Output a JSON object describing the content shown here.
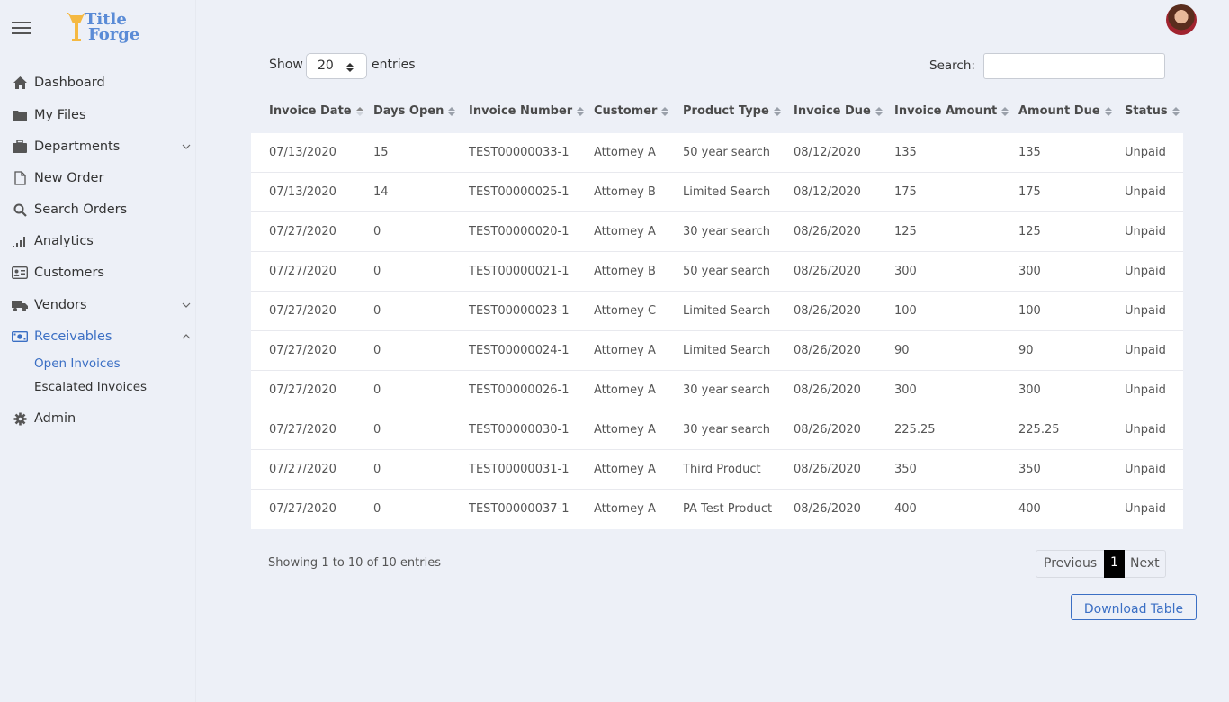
{
  "app": {
    "logo_line1": "Title",
    "logo_line2": "Forge",
    "accent": "#3b6fc4"
  },
  "sidebar": {
    "items": [
      {
        "label": "Dashboard",
        "icon": "home-icon"
      },
      {
        "label": "My Files",
        "icon": "folder-icon"
      },
      {
        "label": "Departments",
        "icon": "briefcase-icon"
      },
      {
        "label": "New Order",
        "icon": "file-icon"
      },
      {
        "label": "Search Orders",
        "icon": "search-icon"
      },
      {
        "label": "Analytics",
        "icon": "signal-bars-icon"
      },
      {
        "label": "Customers",
        "icon": "id-card-icon"
      },
      {
        "label": "Vendors",
        "icon": "truck-icon"
      },
      {
        "label": "Receivables",
        "icon": "money-bill-icon"
      },
      {
        "label": "Admin",
        "icon": "gear-icon"
      }
    ],
    "sub_items": [
      {
        "label": "Open Invoices"
      },
      {
        "label": "Escalated Invoices"
      }
    ]
  },
  "controls": {
    "show_label": "Show",
    "page_size": "20",
    "entries_label": "entries",
    "search_label": "Search:",
    "search_value": ""
  },
  "table": {
    "columns": [
      "Invoice Date",
      "Days Open",
      "Invoice Number",
      "Customer",
      "Product Type",
      "Invoice Due",
      "Invoice Amount",
      "Amount Due",
      "Status"
    ],
    "rows": [
      [
        "07/13/2020",
        "15",
        "TEST00000033-1",
        "Attorney A",
        "50 year search",
        "08/12/2020",
        "135",
        "135",
        "Unpaid"
      ],
      [
        "07/13/2020",
        "14",
        "TEST00000025-1",
        "Attorney B",
        "Limited Search",
        "08/12/2020",
        "175",
        "175",
        "Unpaid"
      ],
      [
        "07/27/2020",
        "0",
        "TEST00000020-1",
        "Attorney A",
        "30 year search",
        "08/26/2020",
        "125",
        "125",
        "Unpaid"
      ],
      [
        "07/27/2020",
        "0",
        "TEST00000021-1",
        "Attorney B",
        "50 year search",
        "08/26/2020",
        "300",
        "300",
        "Unpaid"
      ],
      [
        "07/27/2020",
        "0",
        "TEST00000023-1",
        "Attorney C",
        "Limited Search",
        "08/26/2020",
        "100",
        "100",
        "Unpaid"
      ],
      [
        "07/27/2020",
        "0",
        "TEST00000024-1",
        "Attorney A",
        "Limited Search",
        "08/26/2020",
        "90",
        "90",
        "Unpaid"
      ],
      [
        "07/27/2020",
        "0",
        "TEST00000026-1",
        "Attorney A",
        "30 year search",
        "08/26/2020",
        "300",
        "300",
        "Unpaid"
      ],
      [
        "07/27/2020",
        "0",
        "TEST00000030-1",
        "Attorney A",
        "30 year search",
        "08/26/2020",
        "225.25",
        "225.25",
        "Unpaid"
      ],
      [
        "07/27/2020",
        "0",
        "TEST00000031-1",
        "Attorney A",
        "Third Product",
        "08/26/2020",
        "350",
        "350",
        "Unpaid"
      ],
      [
        "07/27/2020",
        "0",
        "TEST00000037-1",
        "Attorney A",
        "PA Test Product",
        "08/26/2020",
        "400",
        "400",
        "Unpaid"
      ]
    ]
  },
  "footer": {
    "info": "Showing 1 to 10 of 10 entries",
    "previous": "Previous",
    "page": "1",
    "next": "Next",
    "download": "Download Table"
  }
}
